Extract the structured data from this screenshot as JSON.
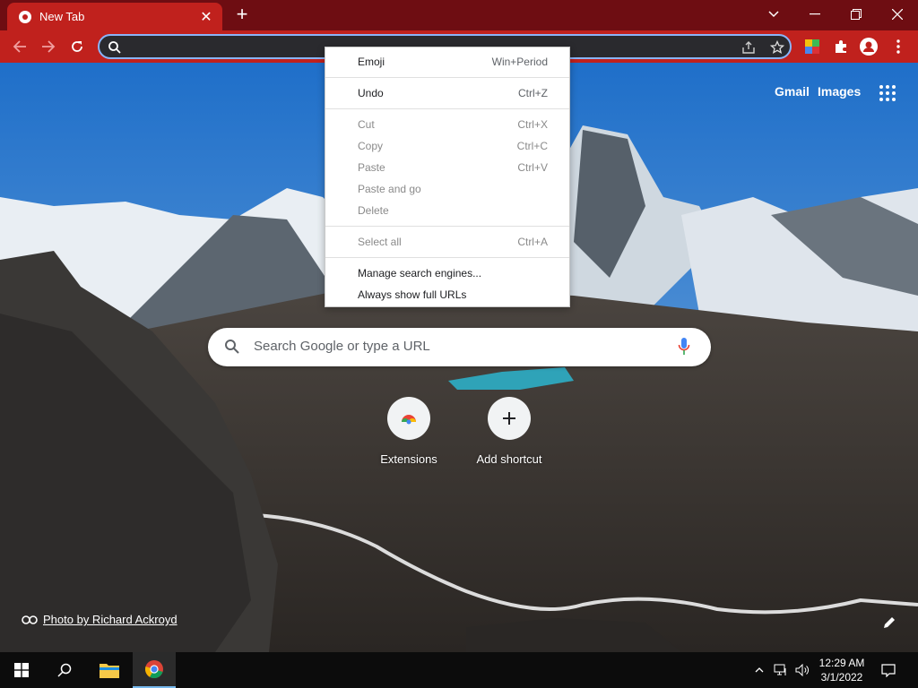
{
  "browser": {
    "tab": {
      "title": "New Tab"
    },
    "omnibox": {
      "value": ""
    }
  },
  "ntp": {
    "links": {
      "gmail": "Gmail",
      "images": "Images"
    },
    "search": {
      "placeholder": "Search Google or type a URL"
    },
    "shortcuts": [
      {
        "label": "Extensions"
      },
      {
        "label": "Add shortcut"
      }
    ],
    "attribution": "Photo by Richard Ackroyd"
  },
  "context_menu": {
    "items": [
      {
        "label": "Emoji",
        "shortcut": "Win+Period",
        "enabled": true
      },
      {
        "label": "Undo",
        "shortcut": "Ctrl+Z",
        "enabled": true
      },
      {
        "label": "Cut",
        "shortcut": "Ctrl+X",
        "enabled": false
      },
      {
        "label": "Copy",
        "shortcut": "Ctrl+C",
        "enabled": false
      },
      {
        "label": "Paste",
        "shortcut": "Ctrl+V",
        "enabled": false
      },
      {
        "label": "Paste and go",
        "shortcut": "",
        "enabled": false
      },
      {
        "label": "Delete",
        "shortcut": "",
        "enabled": false
      },
      {
        "label": "Select all",
        "shortcut": "Ctrl+A",
        "enabled": false
      },
      {
        "label": "Manage search engines...",
        "shortcut": "",
        "enabled": true
      },
      {
        "label": "Always show full URLs",
        "shortcut": "",
        "enabled": true
      }
    ]
  },
  "taskbar": {
    "time": "12:29 AM",
    "date": "3/1/2022"
  },
  "colors": {
    "tab_strip": "#6e0d12",
    "toolbar": "#c0211d",
    "omnibox_focus": "#8ab4f8",
    "taskbar": "#0c0c0c"
  }
}
